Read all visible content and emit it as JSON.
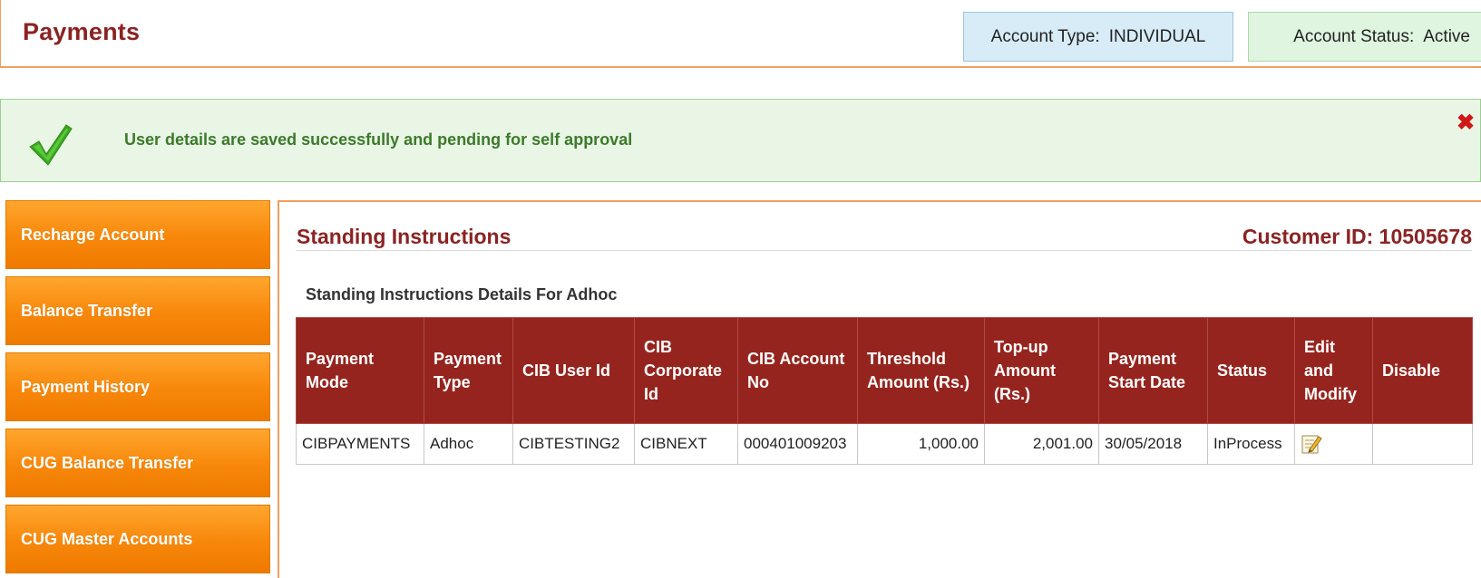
{
  "header": {
    "title": "Payments",
    "account_type_label": "Account Type:",
    "account_type_value": "INDIVIDUAL",
    "account_status_label": "Account Status:",
    "account_status_value": "Active"
  },
  "alert": {
    "message": "User details are saved successfully and pending for self approval",
    "close_icon": "close-icon",
    "check_icon": "checkmark-icon",
    "close_glyph": "✖"
  },
  "sidebar": {
    "items": [
      {
        "label": "Recharge Account"
      },
      {
        "label": "Balance Transfer"
      },
      {
        "label": "Payment History"
      },
      {
        "label": "CUG Balance Transfer"
      },
      {
        "label": "CUG Master Accounts"
      }
    ]
  },
  "main": {
    "title": "Standing Instructions",
    "customer_id": "Customer ID: 10505678",
    "subtitle": "Standing Instructions Details For Adhoc",
    "table": {
      "headers": [
        "Payment Mode",
        "Payment Type",
        "CIB User Id",
        "CIB Corporate Id",
        "CIB Account No",
        "Threshold Amount (Rs.)",
        "Top-up Amount (Rs.)",
        "Payment Start Date",
        "Status",
        "Edit and Modify",
        "Disable"
      ],
      "rows": [
        {
          "payment_mode": "CIBPAYMENTS",
          "payment_type": "Adhoc",
          "cib_user_id": "CIBTESTING2",
          "cib_corporate_id": "CIBNEXT",
          "cib_account_no": "000401009203",
          "threshold_amount": "1,000.00",
          "topup_amount": "2,001.00",
          "payment_start_date": "30/05/2018",
          "status": "InProcess",
          "edit_icon": "edit-icon",
          "disable": ""
        }
      ]
    }
  },
  "colors": {
    "brand_maroon": "#8b2323",
    "table_header": "#96241e",
    "sidebar_orange": "#f7870a",
    "success_bg": "#e9f6e6",
    "success_text": "#3c7a2a",
    "close_red": "#d01818"
  }
}
